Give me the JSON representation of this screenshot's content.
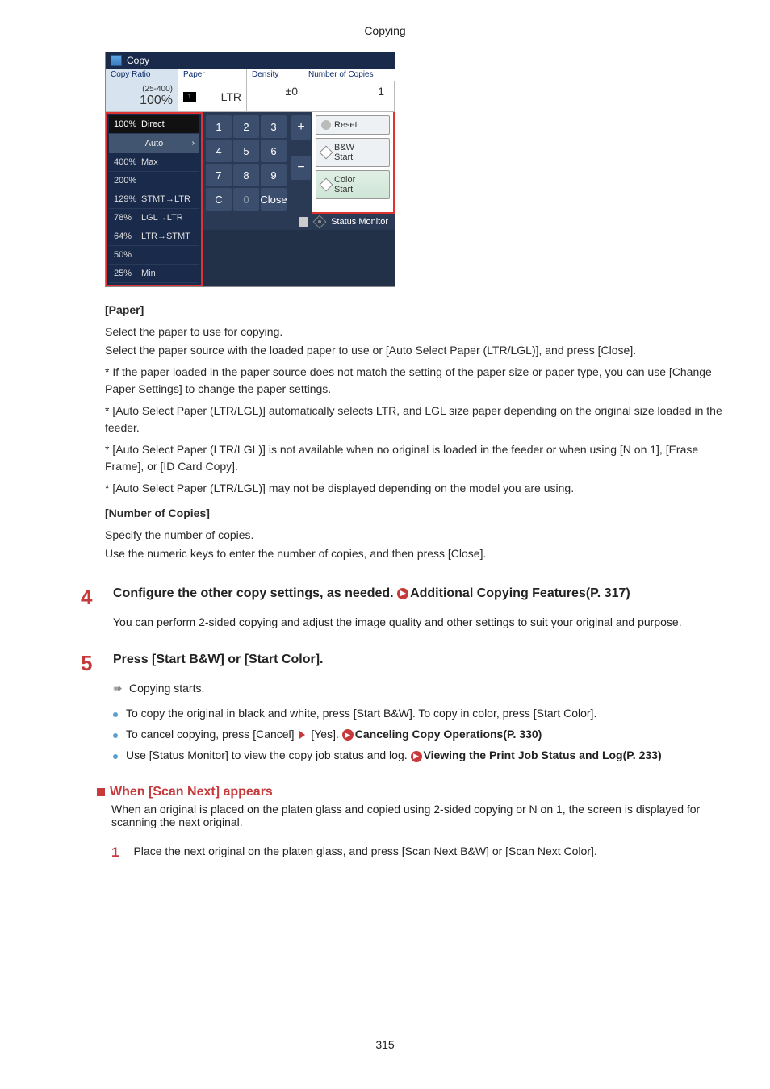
{
  "header_title": "Copying",
  "screenshot": {
    "titlebar": "Copy",
    "sections": {
      "copy_ratio": "Copy Ratio",
      "paper": "Paper",
      "density": "Density",
      "copies": "Number of Copies"
    },
    "values": {
      "ratio_range": "(25-400)",
      "ratio_value": "100%",
      "paper_tray": "1",
      "paper_size": "LTR",
      "density_value": "±0",
      "copies_value": "1"
    },
    "ratio_list": [
      {
        "pct": "100%",
        "label": "Direct",
        "selected": true
      },
      {
        "auto": true,
        "label": "Auto"
      },
      {
        "pct": "400%",
        "label": "Max"
      },
      {
        "pct": "200%",
        "label": ""
      },
      {
        "pct": "129%",
        "label": "STMT→LTR"
      },
      {
        "pct": "78%",
        "label": "LGL→LTR"
      },
      {
        "pct": "64%",
        "label": "LTR→STMT"
      },
      {
        "pct": "50%",
        "label": ""
      },
      {
        "pct": "25%",
        "label": "Min"
      }
    ],
    "keypad": [
      "1",
      "2",
      "3",
      "4",
      "5",
      "6",
      "7",
      "8",
      "9",
      "C",
      "0",
      "Close"
    ],
    "plusminus": [
      "+",
      "−"
    ],
    "actions": {
      "reset": "Reset",
      "bw": "B&W\nStart",
      "color": "Color\nStart"
    },
    "status_monitor": "Status Monitor"
  },
  "body": {
    "paper_heading": "[Paper]",
    "paper_p1": "Select the paper to use for copying.",
    "paper_p1b": "Select the paper source with the loaded paper to use or [Auto Select Paper (LTR/LGL)], and press [Close].",
    "paper_note1": "* If the paper loaded in the paper source does not match the setting of the paper size or paper type, you can use [Change Paper Settings] to change the paper settings.",
    "paper_note2": "* [Auto Select Paper (LTR/LGL)] automatically selects LTR, and LGL size paper depending on the original size loaded in the feeder.",
    "paper_note3": "* [Auto Select Paper (LTR/LGL)] is not available when no original is loaded in the feeder or when using [N on 1], [Erase Frame], or [ID Card Copy].",
    "paper_note4": "* [Auto Select Paper (LTR/LGL)] may not be displayed depending on the model you are using.",
    "copies_heading": "[Number of Copies]",
    "copies_p1": "Specify the number of copies.",
    "copies_p2": "Use the numeric keys to enter the number of copies, and then press [Close].",
    "step4_num": "4",
    "step4_title_pre": "Configure the other copy settings, as needed. ",
    "step4_link": "Additional Copying Features(P. 317)",
    "step4_desc": "You can perform 2-sided copying and adjust the image quality and other settings to suit your original and purpose.",
    "step5_num": "5",
    "step5_title": "Press [Start B&W] or [Start Color].",
    "step5_desc_arrow": "➠",
    "step5_desc": "Copying starts.",
    "bullets": [
      {
        "text_pre": "To copy the original in black and white, press [Start B&W]. To copy in color, press [Start Color]."
      },
      {
        "text_pre": "To cancel copying, press [Cancel] ",
        "tri_after": true,
        "text_mid": " [Yes]. ",
        "link": "Canceling Copy Operations(P. 330)"
      },
      {
        "text_pre": "Use [Status Monitor] to view the copy job status and log. ",
        "link": "Viewing the Print Job Status and Log(P. 233)"
      }
    ],
    "subhead": "When [Scan Next] appears",
    "subhead_desc": "When an original is placed on the platen glass and copied using 2-sided copying or N on 1, the screen is displayed for scanning the next original.",
    "substep_num": "1",
    "substep_text": "Place the next original on the platen glass, and press [Scan Next B&W] or [Scan Next Color].",
    "page_number": "315"
  }
}
